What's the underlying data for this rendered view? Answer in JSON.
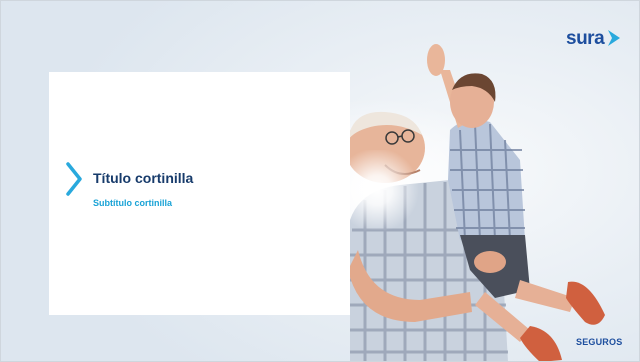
{
  "slide": {
    "title": "Título cortinilla",
    "subtitle": "Subtítulo cortinilla"
  },
  "brand": {
    "logo_text": "sura",
    "footer_text": "SEGUROS"
  },
  "colors": {
    "title": "#173b6b",
    "subtitle": "#1aa3d6",
    "brand_blue": "#1d4e9e",
    "accent_cyan": "#29a9dd"
  },
  "photo": {
    "description_icon": "grandfather-lifting-child-photo"
  }
}
